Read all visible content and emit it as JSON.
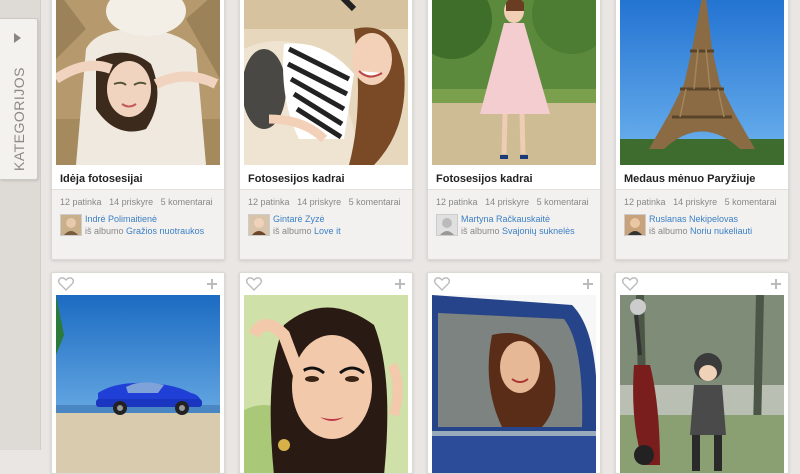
{
  "sidebar": {
    "categories_label": "KATEGORIJOS"
  },
  "cards": [
    {
      "title": "Idėja fotosesijai",
      "likes": "12 patinka",
      "shares": "14 priskyre",
      "comments": "5 komentarai",
      "author": "Indrė Polimaitienė",
      "album_prefix": "iš albumo",
      "album": "Gražios nuotraukos"
    },
    {
      "title": "Fotosesijos kadrai",
      "likes": "12 patinka",
      "shares": "14 priskyre",
      "comments": "5 komentarai",
      "author": "Gintarė Zyzė",
      "album_prefix": "iš albumo",
      "album": "Love it"
    },
    {
      "title": "Fotosesijos kadrai",
      "likes": "12 patinka",
      "shares": "14 priskyre",
      "comments": "5 komentarai",
      "author": "Martyna Račkauskaitė",
      "album_prefix": "iš albumo",
      "album": "Svajonių suknelės"
    },
    {
      "title": "Medaus mėnuo Paryžiuje",
      "likes": "12 patinka",
      "shares": "14 priskyre",
      "comments": "5 komentarai",
      "author": "Ruslanas Nekipelovas",
      "album_prefix": "iš albumo",
      "album": "Noriu nukeliauti"
    }
  ],
  "colors": {
    "link": "#3a7fc4",
    "page_bg": "#e9e6e3"
  }
}
